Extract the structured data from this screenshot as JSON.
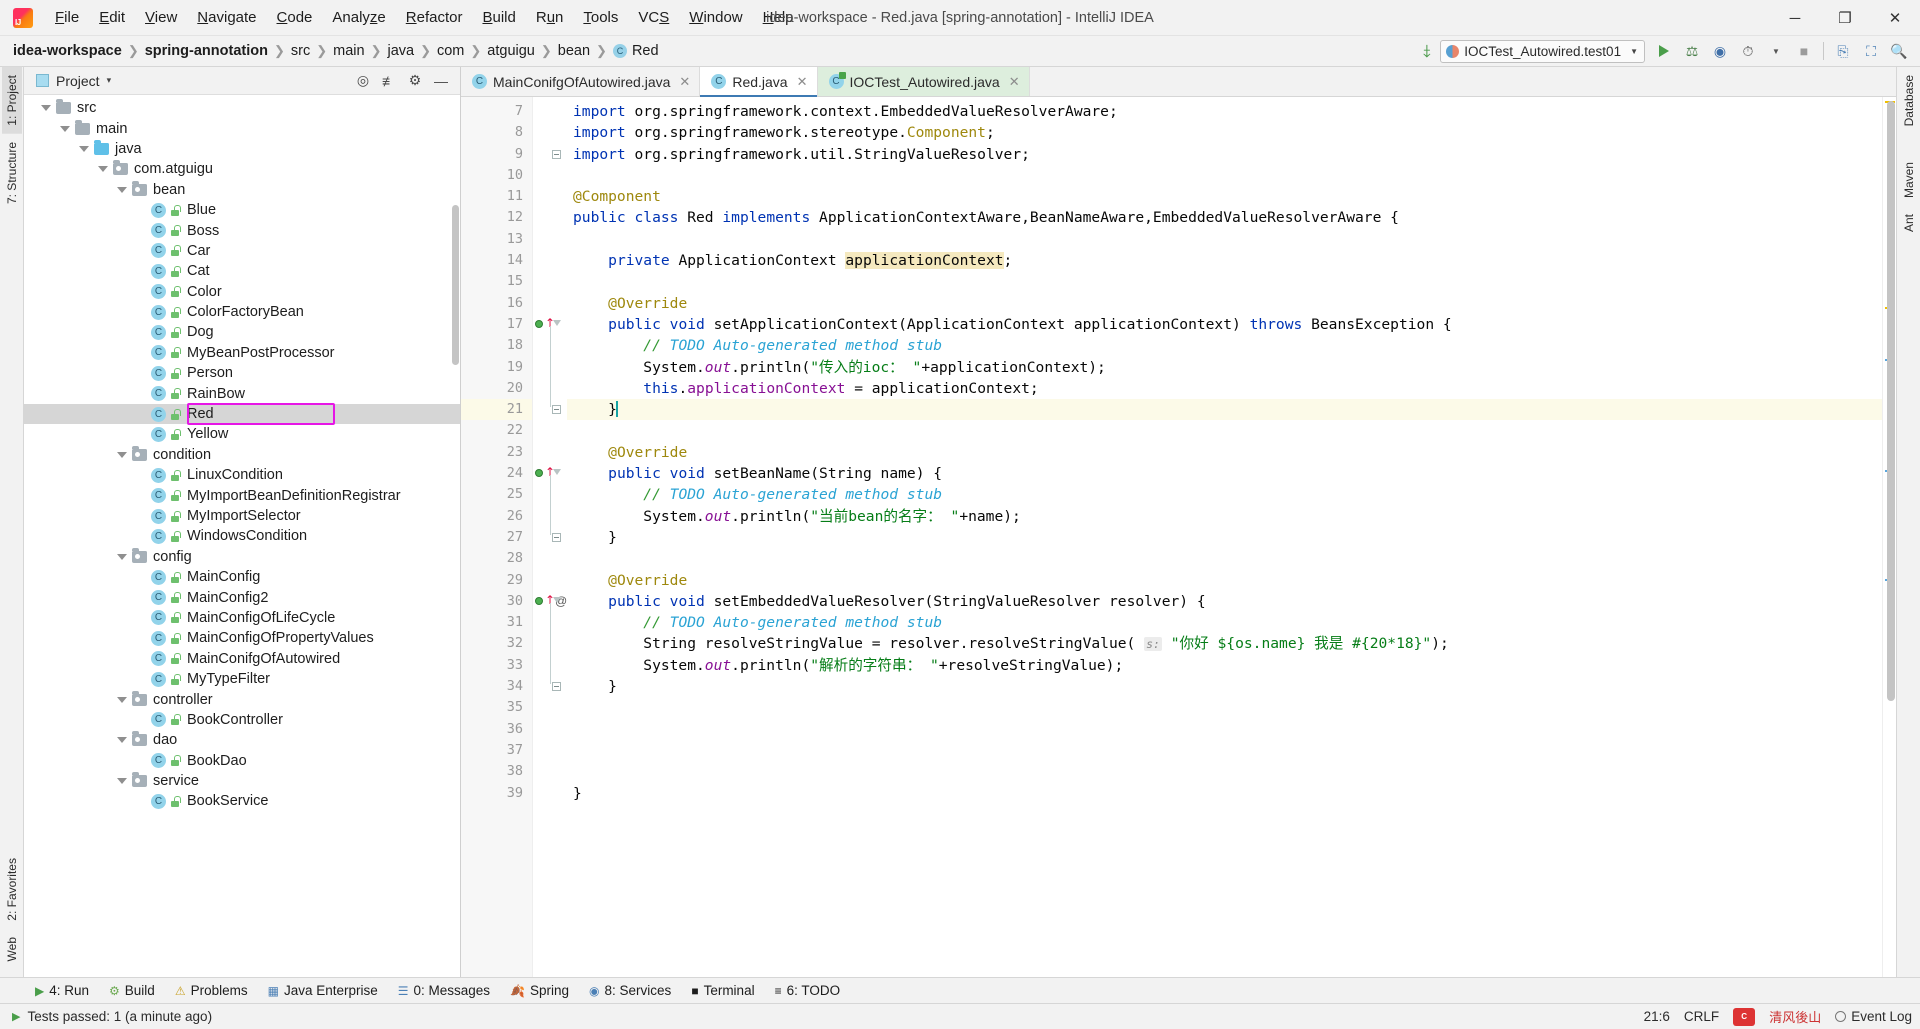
{
  "window": {
    "title": "idea-workspace - Red.java [spring-annotation] - IntelliJ IDEA",
    "minimize": "─",
    "maximize": "❐",
    "close": "✕"
  },
  "menu": [
    {
      "label": "File"
    },
    {
      "label": "Edit"
    },
    {
      "label": "View"
    },
    {
      "label": "Navigate"
    },
    {
      "label": "Code"
    },
    {
      "label": "Analyze"
    },
    {
      "label": "Refactor"
    },
    {
      "label": "Build"
    },
    {
      "label": "Run"
    },
    {
      "label": "Tools"
    },
    {
      "label": "VCS"
    },
    {
      "label": "Window"
    },
    {
      "label": "Help"
    }
  ],
  "breadcrumbs": [
    {
      "label": "idea-workspace",
      "bold": true
    },
    {
      "label": "spring-annotation",
      "bold": true
    },
    {
      "label": "src"
    },
    {
      "label": "main"
    },
    {
      "label": "java"
    },
    {
      "label": "com"
    },
    {
      "label": "atguigu"
    },
    {
      "label": "bean"
    },
    {
      "label": "Red",
      "icon": "class-icon"
    }
  ],
  "toolbar": {
    "run_configuration": "IOCTest_Autowired.test01",
    "build_hammer_icon": "hammer-icon",
    "run_icon": "run-icon",
    "debug_icon": "debug-icon",
    "run_coverage_icon": "run-with-coverage-icon",
    "profiler_icon": "profiler-icon",
    "stop_icon": "stop-icon",
    "update_icon": "update-project-icon",
    "layout_icon": "restore-layout-icon",
    "search_icon": "search-everywhere-icon"
  },
  "left_rail": [
    {
      "label": "1: Project",
      "active": true,
      "icon": "project-icon"
    },
    {
      "label": "7: Structure",
      "active": false,
      "icon": "structure-icon"
    },
    {
      "label": "2: Favorites",
      "active": false,
      "icon": "favorites-icon"
    },
    {
      "label": "Web",
      "active": false,
      "icon": "web-icon"
    }
  ],
  "right_rail": [
    {
      "label": "Database",
      "icon": "database-icon"
    },
    {
      "label": "m",
      "icon": "maven-icon"
    },
    {
      "label": "Maven",
      "icon": "maven-icon"
    },
    {
      "label": "Ant",
      "icon": "ant-icon"
    }
  ],
  "project_panel": {
    "title": "Project",
    "caret": "▾",
    "actions": [
      {
        "name": "locate-icon",
        "glyph": "⌖"
      },
      {
        "name": "collapse-all-icon",
        "glyph": "≡"
      },
      {
        "name": "settings-gear-icon",
        "glyph": "⚙"
      },
      {
        "name": "hide-icon",
        "glyph": "─"
      }
    ],
    "tree": [
      {
        "label": "src",
        "indent": 3,
        "type": "folder",
        "expanded": true
      },
      {
        "label": "main",
        "indent": 4,
        "type": "folder",
        "expanded": true
      },
      {
        "label": "java",
        "indent": 5,
        "type": "folder-blue",
        "expanded": true
      },
      {
        "label": "com.atguigu",
        "indent": 6,
        "type": "package",
        "expanded": true
      },
      {
        "label": "bean",
        "indent": 7,
        "type": "package",
        "expanded": true
      },
      {
        "label": "Blue",
        "indent": 8,
        "type": "class"
      },
      {
        "label": "Boss",
        "indent": 8,
        "type": "class"
      },
      {
        "label": "Car",
        "indent": 8,
        "type": "class"
      },
      {
        "label": "Cat",
        "indent": 8,
        "type": "class"
      },
      {
        "label": "Color",
        "indent": 8,
        "type": "class"
      },
      {
        "label": "ColorFactoryBean",
        "indent": 8,
        "type": "class"
      },
      {
        "label": "Dog",
        "indent": 8,
        "type": "class"
      },
      {
        "label": "MyBeanPostProcessor",
        "indent": 8,
        "type": "class"
      },
      {
        "label": "Person",
        "indent": 8,
        "type": "class"
      },
      {
        "label": "RainBow",
        "indent": 8,
        "type": "class"
      },
      {
        "label": "Red",
        "indent": 8,
        "type": "class",
        "selected": true,
        "highlighted": true
      },
      {
        "label": "Yellow",
        "indent": 8,
        "type": "class"
      },
      {
        "label": "condition",
        "indent": 7,
        "type": "package",
        "expanded": true
      },
      {
        "label": "LinuxCondition",
        "indent": 8,
        "type": "class"
      },
      {
        "label": "MyImportBeanDefinitionRegistrar",
        "indent": 8,
        "type": "class"
      },
      {
        "label": "MyImportSelector",
        "indent": 8,
        "type": "class"
      },
      {
        "label": "WindowsCondition",
        "indent": 8,
        "type": "class"
      },
      {
        "label": "config",
        "indent": 7,
        "type": "package",
        "expanded": true
      },
      {
        "label": "MainConfig",
        "indent": 8,
        "type": "class"
      },
      {
        "label": "MainConfig2",
        "indent": 8,
        "type": "class"
      },
      {
        "label": "MainConfigOfLifeCycle",
        "indent": 8,
        "type": "class"
      },
      {
        "label": "MainConfigOfPropertyValues",
        "indent": 8,
        "type": "class"
      },
      {
        "label": "MainConifgOfAutowired",
        "indent": 8,
        "type": "class"
      },
      {
        "label": "MyTypeFilter",
        "indent": 8,
        "type": "class"
      },
      {
        "label": "controller",
        "indent": 7,
        "type": "package",
        "expanded": true
      },
      {
        "label": "BookController",
        "indent": 8,
        "type": "class"
      },
      {
        "label": "dao",
        "indent": 7,
        "type": "package",
        "expanded": true
      },
      {
        "label": "BookDao",
        "indent": 8,
        "type": "class"
      },
      {
        "label": "service",
        "indent": 7,
        "type": "package",
        "expanded": true
      },
      {
        "label": "BookService",
        "indent": 8,
        "type": "class"
      }
    ]
  },
  "editor_tabs": [
    {
      "label": "MainConifgOfAutowired.java",
      "active": false,
      "icon": "java-class-icon",
      "closable": true
    },
    {
      "label": "Red.java",
      "active": true,
      "icon": "java-class-icon",
      "closable": true
    },
    {
      "label": "IOCTest_Autowired.java",
      "active": false,
      "icon": "java-test-class-icon",
      "closable": true,
      "test": true
    }
  ],
  "code": {
    "first_line": 7,
    "current_line": 21,
    "lines": [
      {
        "n": 7,
        "tokens": [
          {
            "t": "import ",
            "c": "kw"
          },
          {
            "t": "org.springframework.context.EmbeddedValueResolverAware;",
            "c": "plain"
          }
        ],
        "indent": 0
      },
      {
        "n": 8,
        "tokens": [
          {
            "t": "import ",
            "c": "kw"
          },
          {
            "t": "org.springframework.stereotype.",
            "c": "plain"
          },
          {
            "t": "Component",
            "c": "ann"
          },
          {
            "t": ";",
            "c": "plain"
          }
        ],
        "indent": 0
      },
      {
        "n": 9,
        "tokens": [
          {
            "t": "import ",
            "c": "kw"
          },
          {
            "t": "org.springframework.util.StringValueResolver;",
            "c": "plain"
          }
        ],
        "indent": 0,
        "fold": "minus"
      },
      {
        "n": 10,
        "tokens": [],
        "indent": 0
      },
      {
        "n": 11,
        "tokens": [
          {
            "t": "@Component",
            "c": "ann"
          }
        ],
        "indent": 0
      },
      {
        "n": 12,
        "tokens": [
          {
            "t": "public ",
            "c": "kw"
          },
          {
            "t": "class ",
            "c": "kw"
          },
          {
            "t": "Red ",
            "c": "plain"
          },
          {
            "t": "implements ",
            "c": "kw"
          },
          {
            "t": "ApplicationContextAware,BeanNameAware,EmbeddedValueResolverAware {",
            "c": "plain"
          }
        ],
        "indent": 0
      },
      {
        "n": 13,
        "tokens": [],
        "indent": 0
      },
      {
        "n": 14,
        "tokens": [
          {
            "t": "    ",
            "c": "plain"
          },
          {
            "t": "private ",
            "c": "kw"
          },
          {
            "t": "ApplicationContext ",
            "c": "plain"
          },
          {
            "t": "applicationContext",
            "c": "hlvar"
          },
          {
            "t": ";",
            "c": "plain"
          }
        ],
        "indent": 0
      },
      {
        "n": 15,
        "tokens": [],
        "indent": 0
      },
      {
        "n": 16,
        "tokens": [
          {
            "t": "    ",
            "c": "plain"
          },
          {
            "t": "@Override",
            "c": "ann"
          }
        ],
        "indent": 0
      },
      {
        "n": 17,
        "tokens": [
          {
            "t": "    ",
            "c": "plain"
          },
          {
            "t": "public ",
            "c": "kw"
          },
          {
            "t": "void ",
            "c": "kw"
          },
          {
            "t": "setApplicationContext",
            "c": "plain"
          },
          {
            "t": "(ApplicationContext applicationContext) ",
            "c": "plain"
          },
          {
            "t": "throws ",
            "c": "kw"
          },
          {
            "t": "BeansException ",
            "c": "plain"
          },
          {
            "t": "{",
            "c": "brace"
          }
        ],
        "indent": 0,
        "gutter": "override-run",
        "fold": "tri"
      },
      {
        "n": 18,
        "tokens": [
          {
            "t": "        ",
            "c": "plain"
          },
          {
            "t": "// ",
            "c": "cmt-slash"
          },
          {
            "t": "TODO Auto-generated method stub",
            "c": "cmt-todo"
          }
        ],
        "indent": 0
      },
      {
        "n": 19,
        "tokens": [
          {
            "t": "        System.",
            "c": "plain"
          },
          {
            "t": "out",
            "c": "sfld"
          },
          {
            "t": ".println(",
            "c": "plain"
          },
          {
            "t": "\"传入的ioc： \"",
            "c": "str"
          },
          {
            "t": "+applicationContext);",
            "c": "plain"
          }
        ],
        "indent": 0
      },
      {
        "n": 20,
        "tokens": [
          {
            "t": "        ",
            "c": "plain"
          },
          {
            "t": "this",
            "c": "kw"
          },
          {
            "t": ".",
            "c": "plain"
          },
          {
            "t": "applicationContext",
            "c": "fld"
          },
          {
            "t": " = applicationContext;",
            "c": "plain"
          }
        ],
        "indent": 0
      },
      {
        "n": 21,
        "tokens": [
          {
            "t": "    }",
            "c": "plain"
          }
        ],
        "indent": 0,
        "current": true,
        "fold": "minus",
        "caret": true
      },
      {
        "n": 22,
        "tokens": [],
        "indent": 0
      },
      {
        "n": 23,
        "tokens": [
          {
            "t": "    ",
            "c": "plain"
          },
          {
            "t": "@Override",
            "c": "ann"
          }
        ],
        "indent": 0
      },
      {
        "n": 24,
        "tokens": [
          {
            "t": "    ",
            "c": "plain"
          },
          {
            "t": "public ",
            "c": "kw"
          },
          {
            "t": "void ",
            "c": "kw"
          },
          {
            "t": "setBeanName",
            "c": "plain"
          },
          {
            "t": "(String name) {",
            "c": "plain"
          }
        ],
        "indent": 0,
        "gutter": "override-run",
        "fold": "tri"
      },
      {
        "n": 25,
        "tokens": [
          {
            "t": "        ",
            "c": "plain"
          },
          {
            "t": "// ",
            "c": "cmt-slash"
          },
          {
            "t": "TODO Auto-generated method stub",
            "c": "cmt-todo"
          }
        ],
        "indent": 0
      },
      {
        "n": 26,
        "tokens": [
          {
            "t": "        System.",
            "c": "plain"
          },
          {
            "t": "out",
            "c": "sfld"
          },
          {
            "t": ".println(",
            "c": "plain"
          },
          {
            "t": "\"当前bean的名字： \"",
            "c": "str"
          },
          {
            "t": "+name);",
            "c": "plain"
          }
        ],
        "indent": 0
      },
      {
        "n": 27,
        "tokens": [
          {
            "t": "    }",
            "c": "plain"
          }
        ],
        "indent": 0,
        "fold": "minus"
      },
      {
        "n": 28,
        "tokens": [],
        "indent": 0
      },
      {
        "n": 29,
        "tokens": [
          {
            "t": "    ",
            "c": "plain"
          },
          {
            "t": "@Override",
            "c": "ann"
          }
        ],
        "indent": 0
      },
      {
        "n": 30,
        "tokens": [
          {
            "t": "    ",
            "c": "plain"
          },
          {
            "t": "public ",
            "c": "kw"
          },
          {
            "t": "void ",
            "c": "kw"
          },
          {
            "t": "setEmbeddedValueResolver",
            "c": "plain"
          },
          {
            "t": "(StringValueResolver resolver) {",
            "c": "plain"
          }
        ],
        "indent": 0,
        "gutter": "override-run-at",
        "fold": "tri"
      },
      {
        "n": 31,
        "tokens": [
          {
            "t": "        ",
            "c": "plain"
          },
          {
            "t": "// ",
            "c": "cmt-slash"
          },
          {
            "t": "TODO Auto-generated method stub",
            "c": "cmt-todo"
          }
        ],
        "indent": 0
      },
      {
        "n": 32,
        "tokens": [
          {
            "t": "        String resolveStringValue = resolver.resolveStringValue( ",
            "c": "plain"
          },
          {
            "t": "s:",
            "c": "hint"
          },
          {
            "t": " ",
            "c": "plain"
          },
          {
            "t": "\"你好 ${os.name} 我是 #{20*18}\"",
            "c": "str"
          },
          {
            "t": ");",
            "c": "plain"
          }
        ],
        "indent": 0
      },
      {
        "n": 33,
        "tokens": [
          {
            "t": "        System.",
            "c": "plain"
          },
          {
            "t": ".println(",
            "c": "skip"
          },
          {
            "t": "",
            "c": "plain"
          }
        ],
        "indent": 0,
        "raw": true
      },
      {
        "n": 34,
        "tokens": [
          {
            "t": "    }",
            "c": "plain"
          }
        ],
        "indent": 0,
        "fold": "minus"
      },
      {
        "n": 35,
        "tokens": [],
        "indent": 0
      },
      {
        "n": 36,
        "tokens": [],
        "indent": 0
      },
      {
        "n": 37,
        "tokens": [],
        "indent": 0
      },
      {
        "n": 38,
        "tokens": [],
        "indent": 0
      },
      {
        "n": 39,
        "tokens": [
          {
            "t": "}",
            "c": "plain"
          }
        ],
        "indent": 0
      }
    ],
    "line33_parts": {
      "pre": "        System.",
      "out": "out",
      "mid": ".println(",
      "str": "\"解析的字符串： \"",
      "post": "+resolveStringValue);"
    }
  },
  "bottom_tools": [
    {
      "label": "4: Run",
      "icon": "run-icon",
      "mnemonic": "4"
    },
    {
      "label": "Build",
      "icon": "build-icon"
    },
    {
      "label": "Problems",
      "icon": "problems-icon"
    },
    {
      "label": "Java Enterprise",
      "icon": "java-enterprise-icon"
    },
    {
      "label": "0: Messages",
      "icon": "messages-icon",
      "mnemonic": "0"
    },
    {
      "label": "Spring",
      "icon": "spring-icon"
    },
    {
      "label": "8: Services",
      "icon": "services-icon",
      "mnemonic": "8"
    },
    {
      "label": "Terminal",
      "icon": "terminal-icon"
    },
    {
      "label": "6: TODO",
      "icon": "todo-icon",
      "mnemonic": "6"
    }
  ],
  "status_bar": {
    "message": "Tests passed: 1 (a minute ago)",
    "caret_position": "21:6",
    "line_separator": "CRLF",
    "event_log": "Event Log",
    "watermark": "清风後山"
  }
}
